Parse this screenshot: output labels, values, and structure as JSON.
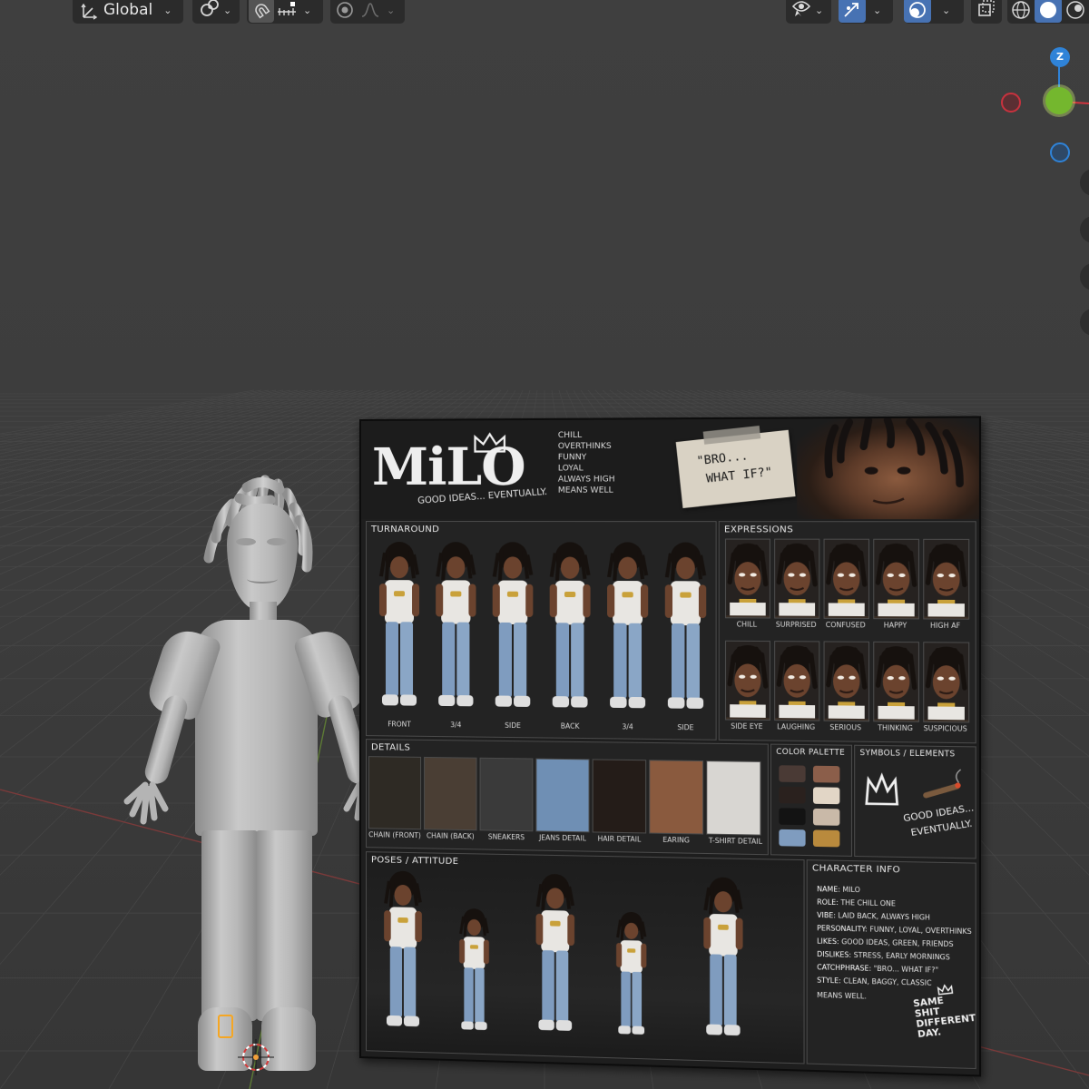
{
  "toolbar": {
    "transform_orientation": "Global",
    "icons": [
      "transform-axes-icon",
      "pivot-point-icon",
      "snap-icon",
      "snap-increment-icon",
      "proportional-editing-icon",
      "falloff-curve-icon",
      "visibility-icon",
      "gizmo-icon",
      "overlays-icon",
      "xray-icon",
      "wireframe-shading-icon",
      "solid-shading-icon",
      "material-shading-icon"
    ]
  },
  "gizmo": {
    "z_label": "Z"
  },
  "sheet": {
    "title": "MiLO",
    "tagline": "GOOD IDEAS... EVENTUALLY.",
    "traits": [
      "CHILL",
      "OVERTHINKS",
      "FUNNY",
      "LOYAL",
      "ALWAYS HIGH",
      "MEANS WELL"
    ],
    "quote_line1": "\"BRO...",
    "quote_line2": "WHAT IF?\"",
    "turnaround": {
      "title": "TURNAROUND",
      "views": [
        "FRONT",
        "3/4",
        "SIDE",
        "BACK",
        "3/4",
        "SIDE"
      ]
    },
    "expressions": {
      "title": "EXPRESSIONS",
      "row1": [
        "CHILL",
        "SURPRISED",
        "CONFUSED",
        "HAPPY",
        "HIGH AF"
      ],
      "row2": [
        "SIDE EYE",
        "LAUGHING",
        "SERIOUS",
        "THINKING",
        "SUSPICIOUS"
      ]
    },
    "details": {
      "title": "DETAILS",
      "items": [
        "CHAIN (FRONT)",
        "CHAIN (BACK)",
        "SNEAKERS",
        "JEANS DETAIL",
        "HAIR DETAIL",
        "EARING",
        "T-SHIRT DETAIL"
      ]
    },
    "palette": {
      "title": "COLOR PALETTE",
      "colors": [
        "#4a3a35",
        "#8b5e4a",
        "#2a211e",
        "#e2d6c6",
        "#131313",
        "#c9b9a8",
        "#7f9cbf",
        "#b98a3d"
      ]
    },
    "symbols": {
      "title": "SYMBOLS / ELEMENTS",
      "text1": "GOOD IDEAS...",
      "text2": "EVENTUALLY."
    },
    "poses": {
      "title": "POSES / ATTITUDE"
    },
    "info": {
      "title": "CHARACTER INFO",
      "lines": [
        {
          "k": "NAME:",
          "v": "MILO"
        },
        {
          "k": "ROLE:",
          "v": "THE CHILL ONE"
        },
        {
          "k": "VIBE:",
          "v": "LAID BACK, ALWAYS HIGH"
        },
        {
          "k": "PERSONALITY:",
          "v": "FUNNY, LOYAL, OVERTHINKS"
        },
        {
          "k": "LIKES:",
          "v": "GOOD IDEAS, GREEN, FRIENDS"
        },
        {
          "k": "DISLIKES:",
          "v": "STRESS, EARLY MORNINGS"
        },
        {
          "k": "CATCHPHRASE:",
          "v": "\"BRO... WHAT IF?\""
        },
        {
          "k": "STYLE:",
          "v": "CLEAN, BAGGY, CLASSIC"
        },
        {
          "k": "",
          "v": "MEANS WELL."
        }
      ],
      "motto": [
        "SAME",
        "SHIT",
        "DIFFERENT",
        "DAY."
      ]
    }
  }
}
